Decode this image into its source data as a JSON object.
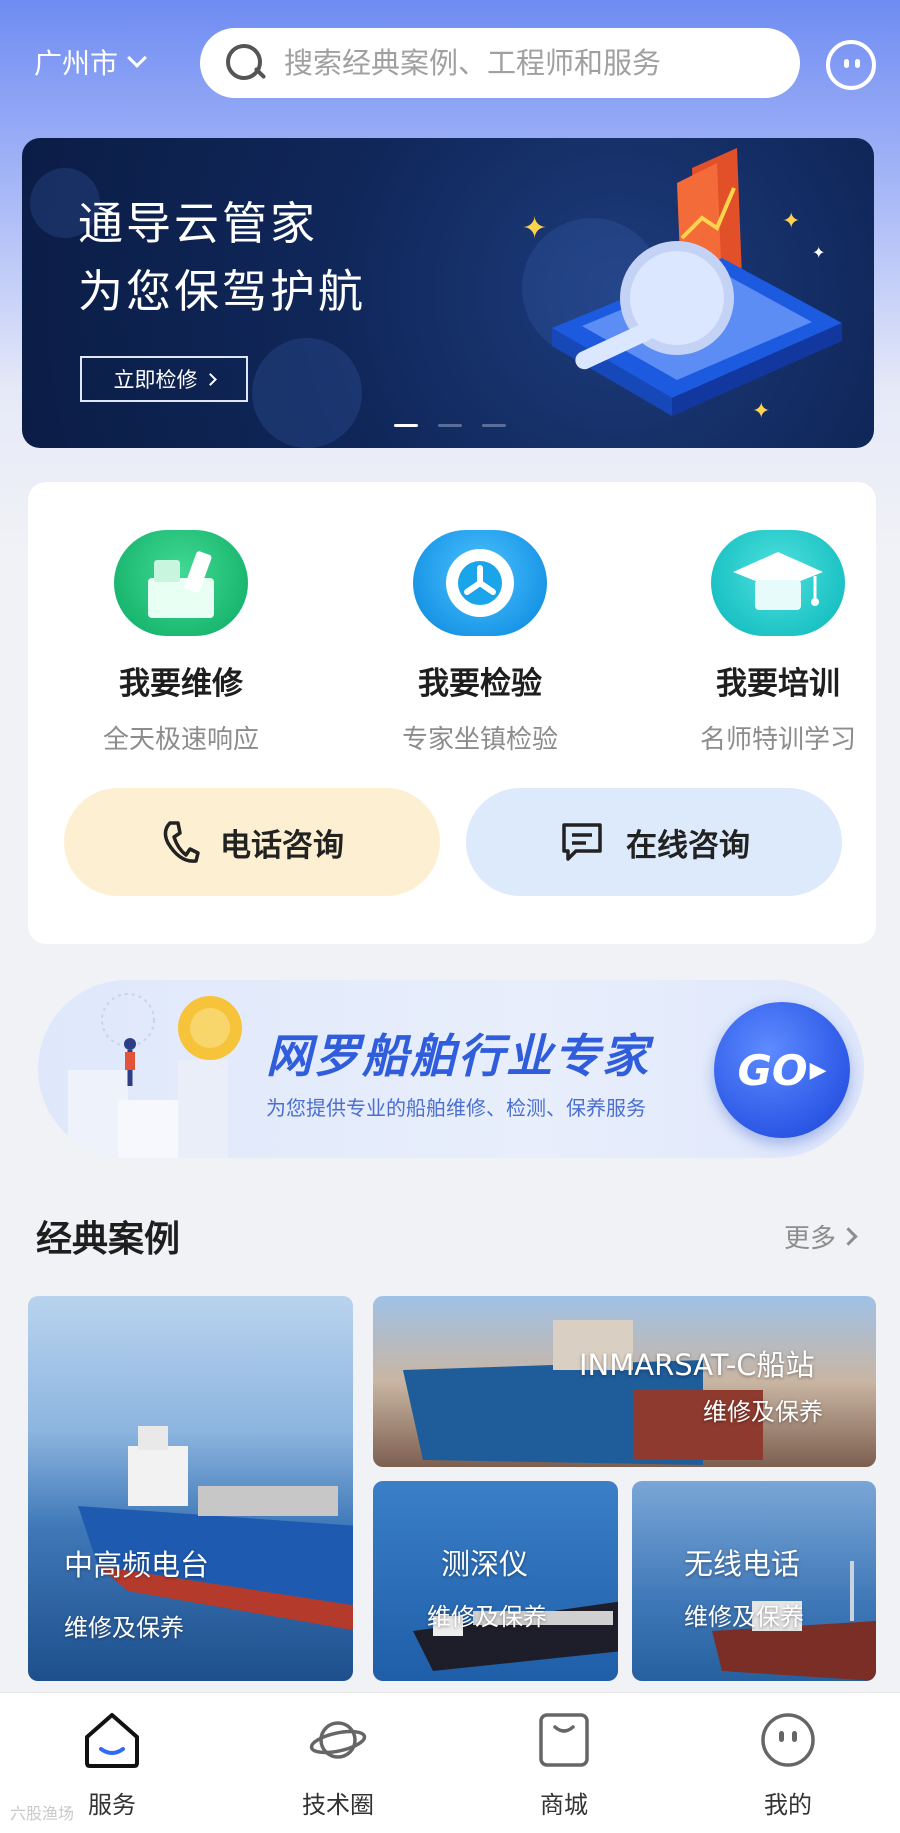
{
  "header": {
    "city": "广州市",
    "search_placeholder": "搜索经典案例、工程师和服务"
  },
  "banner": {
    "title_line1": "通导云管家",
    "title_line2": "为您保驾护航",
    "button_label": "立即检修",
    "page_index": 1,
    "page_count": 3
  },
  "services": [
    {
      "name": "我要维修",
      "sub": "全天极速响应",
      "icon": "repair-icon",
      "color": "#1fbf78"
    },
    {
      "name": "我要检验",
      "sub": "专家坐镇检验",
      "icon": "inspect-gear-icon",
      "color": "#1aa4ea"
    },
    {
      "name": "我要培训",
      "sub": "名师特训学习",
      "icon": "graduation-cap-icon",
      "color": "#1fc7c6"
    }
  ],
  "consult": {
    "phone_label": "电话咨询",
    "online_label": "在线咨询"
  },
  "promo": {
    "title": "网罗船舶行业专家",
    "subtitle": "为您提供专业的船舶维修、检测、保养服务",
    "go_label": "GO"
  },
  "cases_section": {
    "title": "经典案例",
    "more_label": "更多"
  },
  "cases": [
    {
      "title": "中高频电台",
      "sub": "维修及保养"
    },
    {
      "title": "INMARSAT-C船站",
      "sub": "维修及保养"
    },
    {
      "title": "测深仪",
      "sub": "维修及保养"
    },
    {
      "title": "无线电话",
      "sub": "维修及保养"
    }
  ],
  "tabbar": [
    {
      "label": "服务",
      "icon": "home-icon",
      "active": true
    },
    {
      "label": "技术圈",
      "icon": "planet-icon",
      "active": false
    },
    {
      "label": "商城",
      "icon": "shopping-bag-icon",
      "active": false
    },
    {
      "label": "我的",
      "icon": "profile-face-icon",
      "active": false
    }
  ],
  "watermark": "六股渔场",
  "colors": {
    "accent": "#2f5ddb",
    "phone_btn_bg": "#fdf0d2",
    "online_btn_bg": "#ddeafb"
  }
}
